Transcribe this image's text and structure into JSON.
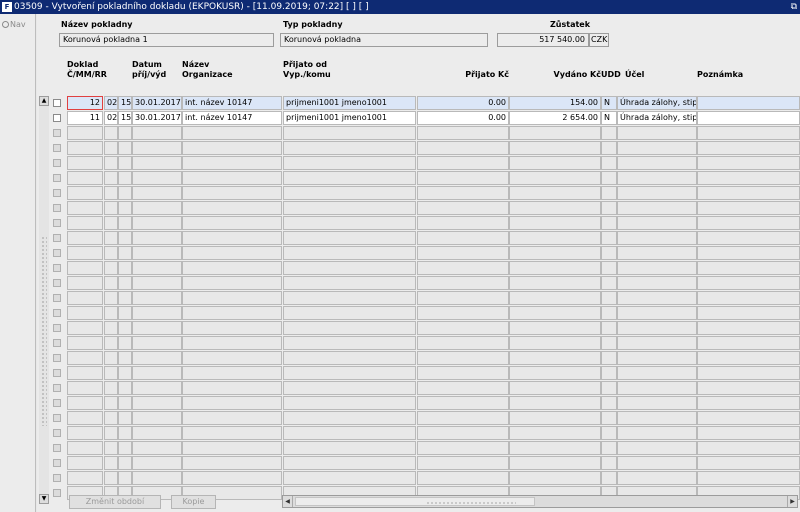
{
  "titlebar": {
    "icon": "app-logo-icon",
    "title": "03509 - Vytvoření pokladního dokladu (EKPOKUSR) - [11.09.2019; 07:22]  [ ]  [ ]",
    "restore": "⧉"
  },
  "nav": {
    "label": "Nav"
  },
  "header": {
    "nazev_label": "Název pokladny",
    "nazev_value": "Korunová pokladna 1",
    "typ_label": "Typ pokladny",
    "typ_value": "Korunová pokladna",
    "zustatek_label": "Zůstatek",
    "zustatek_value": "517 540.00",
    "mena": "CZK"
  },
  "columns": {
    "doklad": "Doklad",
    "cmmrr": "Č/MM/RR",
    "datum": "Datum",
    "prijvyd": "příj/výd",
    "nazev": "Název",
    "organizace": "Organizace",
    "prijato_od": "Přijato od",
    "vyp_komu": "Vyp./komu",
    "prijato_kc": "Přijato Kč",
    "vydano_kc": "Vydáno Kč",
    "udd": "UDD",
    "ucel": "Účel",
    "poznamka": "Poznámka"
  },
  "rows": [
    {
      "cislo": "12",
      "mm": "02",
      "rr": "15",
      "datum": "30.01.2017",
      "organizace": "int. název 10147",
      "osoba": "prijmeni1001 jmeno1001",
      "prijato": "0.00",
      "vydano": "154.00",
      "udd": "N",
      "ucel": "Úhrada zálohy, stipe",
      "poznamka": ""
    },
    {
      "cislo": "11",
      "mm": "02",
      "rr": "15",
      "datum": "30.01.2017",
      "organizace": "int. název 10147",
      "osoba": "prijmeni1001 jmeno1001",
      "prijato": "0.00",
      "vydano": "2 654.00",
      "udd": "N",
      "ucel": "Úhrada zálohy, stipe",
      "poznamka": ""
    }
  ],
  "empty_row_count": 25,
  "buttons": {
    "zmenit": "Změnit období",
    "kopie": "Kopie"
  },
  "scroll": {
    "up": "▲",
    "down": "▼",
    "left": "◀",
    "right": "▶"
  }
}
